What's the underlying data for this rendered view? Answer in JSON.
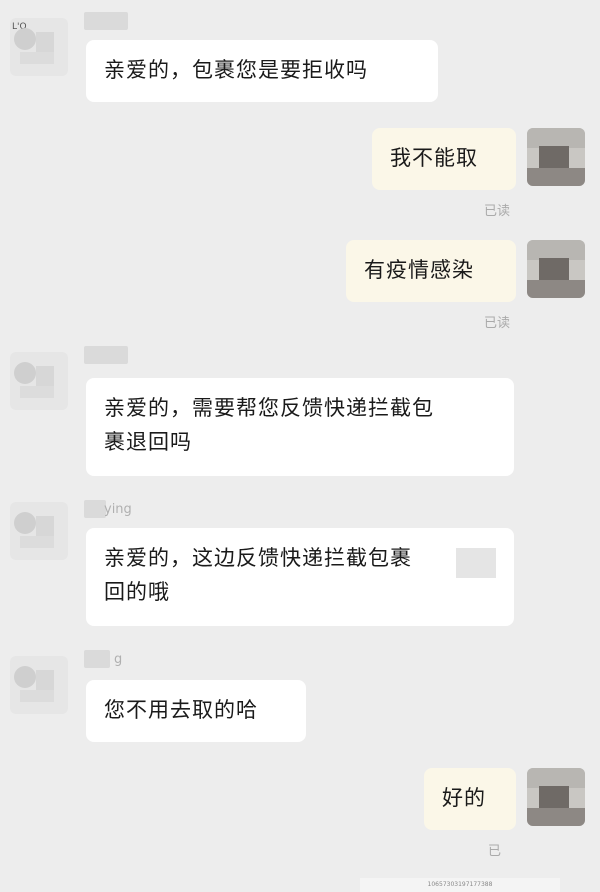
{
  "messages": [
    {
      "side": "left",
      "text": "亲爱的，包裹您是要拒收吗"
    },
    {
      "side": "right",
      "text": "我不能取",
      "status": "已读"
    },
    {
      "side": "right",
      "text": "有疫情感染",
      "status": "已读"
    },
    {
      "side": "left",
      "text_line1": "亲爱的，需要帮您反馈快递拦截包",
      "text_line2": "裹退回吗"
    },
    {
      "side": "left",
      "text_line1": "亲爱的，这边反馈快递拦截包裹",
      "text_line2": "回的哦"
    },
    {
      "side": "left",
      "text": "您不用去取的哈"
    },
    {
      "side": "right",
      "text": "好的",
      "status": "已"
    }
  ],
  "avatars": {
    "left_logo": "L'O"
  },
  "names": {
    "n3_suffix": "ying",
    "n4_suffix": "g"
  },
  "footer": {
    "code": "10657303197177388"
  },
  "colors": {
    "background": "#ededed",
    "left_bubble": "#ffffff",
    "right_bubble": "#fbf7e8",
    "read_status": "#aaaaaa"
  }
}
